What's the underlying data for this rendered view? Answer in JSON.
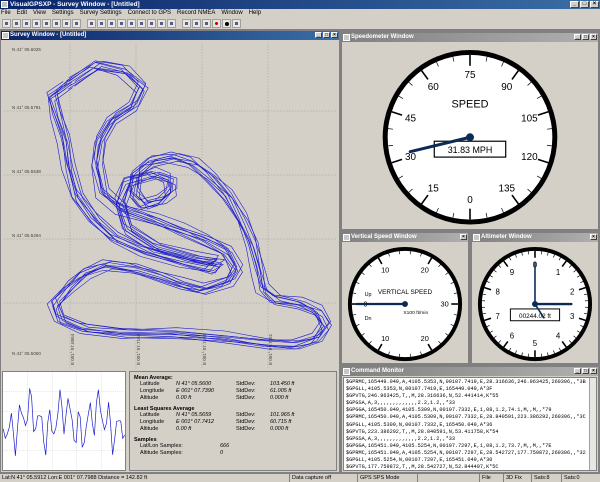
{
  "app_title": "VisualGPSXP - Survey Window - [Untitled]",
  "menu": [
    "File",
    "Edit",
    "View",
    "Settings",
    "Survey Settings",
    "Connect to GPS",
    "Record NMEA",
    "Window",
    "Help"
  ],
  "toolbar_icons": [
    "new-icon",
    "open-icon",
    "save-icon",
    "print-icon",
    "cut-icon",
    "copy-icon",
    "paste-icon",
    "about-icon",
    "grid-icon",
    "fill-icon",
    "zoom-fit-icon",
    "circle-icon",
    "center-icon",
    "hand-icon",
    "zoom-in-icon",
    "zoom-out-icon",
    "check-icon",
    "map-icon",
    "layers-icon",
    "settings-icon",
    "record-icon",
    "stop-icon",
    "connect-icon"
  ],
  "survey": {
    "title": "Survey Window - [Untitled]",
    "lat_labels": [
      "N 41° 05.6025",
      "N 41° 05.5781",
      "N 41° 05.5538",
      "N 41° 05.5294",
      "N 41° 05.5050"
    ],
    "lon_labels": [
      "E 001° 07.6864",
      "E 001° 07.7163",
      "E 001° 07.7462",
      "E 001° 07.7761",
      "E 001° 07.8060"
    ]
  },
  "stats": {
    "mean_title": "Mean Average:",
    "mean": [
      {
        "label": "Latitude",
        "value": "N 41° 05.5600",
        "sd_label": "StdDev:",
        "sd": "103.450 ft"
      },
      {
        "label": "Longitude",
        "value": "E 001° 07.7390",
        "sd_label": "StdDev:",
        "sd": "61.005 ft"
      },
      {
        "label": "Altitude",
        "value": "0.00 ft",
        "sd_label": "StdDev:",
        "sd": "0.000 ft"
      }
    ],
    "ls_title": "Least Squares Average",
    "ls": [
      {
        "label": "Latitude",
        "value": "N 41° 05.5659",
        "sd_label": "StdDev:",
        "sd": "101.965 ft"
      },
      {
        "label": "Longitude",
        "value": "E 001° 07.7412",
        "sd_label": "StdDev:",
        "sd": "60.715 ft"
      },
      {
        "label": "Altitude",
        "value": "0.00 ft",
        "sd_label": "StdDev:",
        "sd": "0.000 ft"
      }
    ],
    "samples_title": "Samples",
    "samples": [
      {
        "label": "Lat/Lon Samples:",
        "value": "666"
      },
      {
        "label": "Altitude Samples:",
        "value": "0"
      }
    ]
  },
  "speedometer": {
    "title": "Speedometer Window",
    "label": "SPEED",
    "readout": "31.83 MPH",
    "ticks": [
      "0",
      "15",
      "30",
      "45",
      "60",
      "75",
      "90",
      "105",
      "120",
      "135"
    ],
    "value_mph": 31.83
  },
  "vspeed": {
    "title": "Vertical Speed Window",
    "label": "VERTICAL SPEED",
    "units": "X100 ft/min",
    "up": "Up",
    "dn": "Dn",
    "ticks": [
      "0",
      "10",
      "20",
      "30",
      "20",
      "10"
    ],
    "value": 0
  },
  "altimeter": {
    "title": "Altimeter Window",
    "readout": "00244.02 ft",
    "ticks": [
      "0",
      "1",
      "2",
      "3",
      "4",
      "5",
      "6",
      "7",
      "8",
      "9"
    ],
    "value_ft": 244.02
  },
  "command_monitor": {
    "title": "Command Monitor",
    "lines": [
      "$GPRMC,165449.049,A,4105.5353,N,00107.7419,E,28.316636,246.963425,260306,,*3B",
      "$GPGLL,4105.5353,N,00107.7419,E,165449.049,A*3F",
      "$GPVTG,246.963425,T,,M,28.316636,N,52.441414,K*55",
      "$GPGSA,A,3,,,,,,,,,,,,,2.2,1.2,,*33",
      "$GPGGA,165450.049,4105.5309,N,00107.7332,E,1,08,1.2,74.1,M,,M,,*79",
      "$GPRMC,165450.049,A,4105.5309,N,00107.7332,E,28.840591,223.386292,260306,,*3C",
      "$GPGLL,4105.5309,N,00107.7332,E,165450.049,A*36",
      "$GPVTG,223.386292,T,,M,28.840591,N,53.411758,K*54",
      "$GPGSA,A,3,,,,,,,,,,,,,2.2,1.2,,*33",
      "$GPGGA,165451.049,4105.5254,N,00107.7297,E,1,08,1.2,73.7,M,,M,,*7E",
      "$GPRMC,165451.049,A,4105.5254,N,00107.7297,E,28.542727,177.759872,260306,,*32",
      "$GPGLL,4105.5254,N,00107.7297,E,165451.049,A*30",
      "$GPVTG,177.759872,T,,M,28.542727,N,52.844497,K*5C",
      "$GPGSA,A,3,,,,,,,,,,,,,2.2,1.2,,*33",
      "$GPGGA,165452.049,4105.5206,N,00107.7337,E,1,08,1.2,73.1,M,,M,,*"
    ]
  },
  "statusbar": {
    "cursor": "Lat:N 41° 05.5912  Lon:E 001° 07.7988  Distance = 142.82 ft",
    "capture": "Data capture off",
    "mode": "GPS SPS Mode",
    "fix_file": "File",
    "fix": "3D Fix",
    "sats": "Sats:8",
    "extra": "Sats:0"
  }
}
